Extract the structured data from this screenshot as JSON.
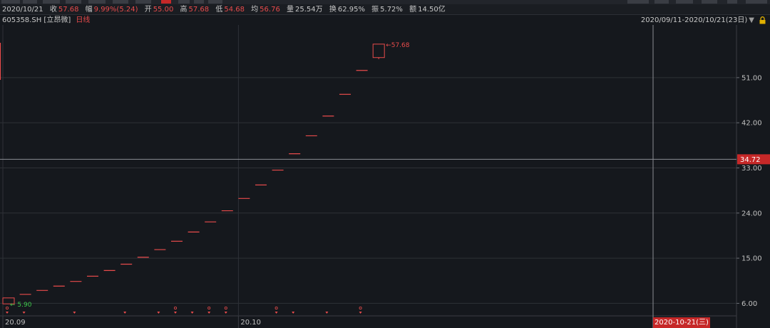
{
  "infobar": {
    "date": "2020/10/21",
    "close_label": "收",
    "close": "57.68",
    "change_label": "幅",
    "change": "9.99%(5.24)",
    "open_label": "开",
    "open": "55.00",
    "high_label": "高",
    "high": "57.68",
    "low_label": "低",
    "low": "54.68",
    "avg_label": "均",
    "avg": "56.76",
    "volume_label": "量",
    "volume": "25.54万",
    "turnover_label": "换",
    "turnover": "62.95%",
    "amplitude_label": "振",
    "amplitude": "5.72%",
    "amount_label": "额",
    "amount": "14.50亿"
  },
  "subbar": {
    "code": "605358.SH",
    "name": "[立昂微]",
    "period": "日线",
    "range": "2020/09/11-2020/10/21(23日)",
    "range_arrow": "▼"
  },
  "colors": {
    "background": "#15181d",
    "up": "#e84b4b",
    "down_label": "#3cc84a",
    "grid": "#2e3137",
    "price_tag": "#c62828"
  },
  "icons": {
    "lock": "lock-icon",
    "range_dropdown": "chevron-down-icon"
  },
  "end_badge": "2020-10-21(三)",
  "chart_data": {
    "type": "candlestick",
    "title": "",
    "yticks": [
      6.0,
      15.0,
      24.0,
      33.0,
      42.0,
      51.0
    ],
    "ylim": [
      3.5,
      61.5
    ],
    "xticks": [
      {
        "label": "20.09",
        "index": 0
      },
      {
        "label": "20.10",
        "index": 14
      }
    ],
    "current_price": 34.72,
    "max_label": "57.68",
    "min_label": "5.90",
    "candles": [
      {
        "o": 5.9,
        "h": 7.08,
        "l": 5.9,
        "c": 7.08
      },
      {
        "o": 7.79,
        "h": 7.79,
        "l": 7.79,
        "c": 7.79
      },
      {
        "o": 8.57,
        "h": 8.57,
        "l": 8.57,
        "c": 8.57
      },
      {
        "o": 9.43,
        "h": 9.43,
        "l": 9.43,
        "c": 9.43
      },
      {
        "o": 10.37,
        "h": 10.37,
        "l": 10.37,
        "c": 10.37
      },
      {
        "o": 11.41,
        "h": 11.41,
        "l": 11.41,
        "c": 11.41
      },
      {
        "o": 12.55,
        "h": 12.55,
        "l": 12.55,
        "c": 12.55
      },
      {
        "o": 13.81,
        "h": 13.81,
        "l": 13.81,
        "c": 13.81
      },
      {
        "o": 15.19,
        "h": 15.19,
        "l": 15.19,
        "c": 15.19
      },
      {
        "o": 16.71,
        "h": 16.71,
        "l": 16.71,
        "c": 16.71
      },
      {
        "o": 18.38,
        "h": 18.38,
        "l": 18.38,
        "c": 18.38
      },
      {
        "o": 20.22,
        "h": 20.22,
        "l": 20.22,
        "c": 20.22
      },
      {
        "o": 22.24,
        "h": 22.24,
        "l": 22.24,
        "c": 22.24
      },
      {
        "o": 24.46,
        "h": 24.46,
        "l": 24.46,
        "c": 24.46
      },
      {
        "o": 26.91,
        "h": 26.91,
        "l": 26.91,
        "c": 26.91
      },
      {
        "o": 29.6,
        "h": 29.6,
        "l": 29.6,
        "c": 29.6
      },
      {
        "o": 32.56,
        "h": 32.56,
        "l": 32.56,
        "c": 32.56
      },
      {
        "o": 35.82,
        "h": 35.82,
        "l": 35.82,
        "c": 35.82
      },
      {
        "o": 39.4,
        "h": 39.4,
        "l": 39.4,
        "c": 39.4
      },
      {
        "o": 43.34,
        "h": 43.34,
        "l": 43.34,
        "c": 43.34
      },
      {
        "o": 47.67,
        "h": 47.67,
        "l": 47.67,
        "c": 47.67
      },
      {
        "o": 52.44,
        "h": 52.44,
        "l": 52.44,
        "c": 52.44
      },
      {
        "o": 55.0,
        "h": 57.68,
        "l": 54.68,
        "c": 57.68
      }
    ],
    "markers": [
      {
        "index": 0,
        "type": "R"
      },
      {
        "index": 1,
        "type": "T"
      },
      {
        "index": 4,
        "type": "T"
      },
      {
        "index": 7,
        "type": "T"
      },
      {
        "index": 9,
        "type": "T"
      },
      {
        "index": 10,
        "type": "R"
      },
      {
        "index": 11,
        "type": "T"
      },
      {
        "index": 12,
        "type": "R"
      },
      {
        "index": 13,
        "type": "R"
      },
      {
        "index": 16,
        "type": "R"
      },
      {
        "index": 17,
        "type": "T"
      },
      {
        "index": 19,
        "type": "T"
      },
      {
        "index": 21,
        "type": "R"
      }
    ]
  }
}
